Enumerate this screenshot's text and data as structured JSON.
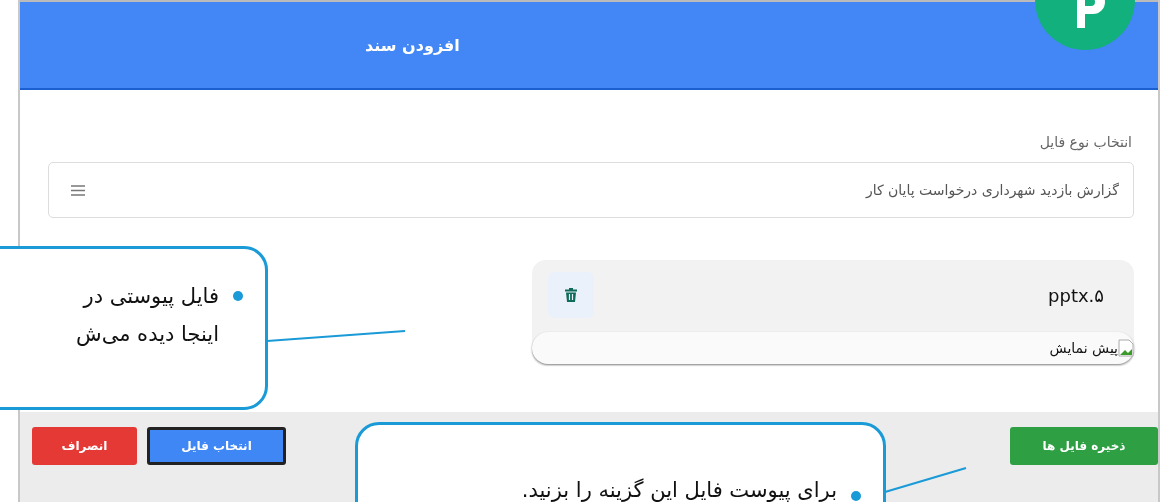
{
  "header": {
    "title": "افزودن سند"
  },
  "file_type": {
    "label": "انتخاب نوع فایل",
    "value": "گزارش بازدید شهرداری درخواست پایان کار"
  },
  "attachments": [
    {
      "name": "۵.pptx",
      "preview_alt": "پیش نمایش"
    }
  ],
  "buttons": [
    {
      "label": "ذخیره فایل ها",
      "kind": "save"
    },
    {
      "label": "انتخاب فایل",
      "kind": "choose"
    },
    {
      "label": "انصراف",
      "kind": "cancel"
    }
  ],
  "callouts": [
    {
      "lines": [
        "فایل پیوستی در",
        "اینجا دیده می‌ش"
      ]
    },
    {
      "lines": [
        "برای پیوست فایل این گزینه را بزنید."
      ]
    }
  ]
}
